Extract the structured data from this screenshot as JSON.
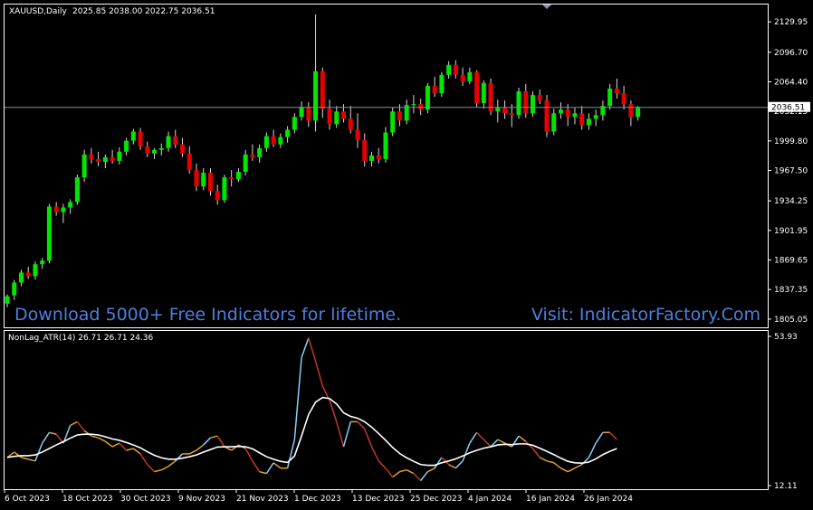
{
  "main": {
    "symbol_label": "XAUUSD,Daily",
    "ohlc_label": "2025.85 2038.00 2022.75 2036.51",
    "current_price_label": "2036.51",
    "banner_left": "Download 5000+ Free Indicators for lifetime.",
    "banner_right": "Visit: IndicatorFactory.Com"
  },
  "indicator": {
    "label": "NonLag_ATR(14) 26.71 26.71 24.36"
  },
  "colors": {
    "bull": "#00e600",
    "bear": "#e60000",
    "wick": "#d9d9d9",
    "grid_line": "#7f8f9f",
    "atr_up": "#87cefa",
    "atr_down": "#e0a030",
    "atr_mid": "#c0392b",
    "signal": "#ffffff",
    "banner": "#4d7fe0"
  },
  "chart_data": [
    {
      "type": "candlestick",
      "name": "price",
      "ylim": [
        1800.0,
        2140.0
      ],
      "y_ticks": [
        "2129.95",
        "2096.70",
        "2064.40",
        "2032.15",
        "1999.80",
        "1967.50",
        "1934.25",
        "1901.95",
        "1869.65",
        "1837.35",
        "1805.05"
      ],
      "current_price": 2036.51,
      "ohlc": [
        [
          1822,
          1832,
          1818,
          1830
        ],
        [
          1831,
          1848,
          1826,
          1845
        ],
        [
          1845,
          1859,
          1841,
          1856
        ],
        [
          1856,
          1862,
          1849,
          1852
        ],
        [
          1852,
          1868,
          1848,
          1865
        ],
        [
          1865,
          1872,
          1860,
          1869
        ],
        [
          1869,
          1931,
          1866,
          1928
        ],
        [
          1928,
          1933,
          1918,
          1922
        ],
        [
          1922,
          1931,
          1910,
          1927
        ],
        [
          1927,
          1936,
          1920,
          1933
        ],
        [
          1933,
          1963,
          1930,
          1960
        ],
        [
          1960,
          1990,
          1955,
          1985
        ],
        [
          1985,
          1992,
          1975,
          1980
        ],
        [
          1980,
          1988,
          1972,
          1977
        ],
        [
          1977,
          1985,
          1970,
          1982
        ],
        [
          1982,
          1990,
          1975,
          1978
        ],
        [
          1978,
          1993,
          1974,
          1988
        ],
        [
          1988,
          2003,
          1984,
          2000
        ],
        [
          2000,
          2013,
          1996,
          2010
        ],
        [
          2010,
          2014,
          1990,
          1994
        ],
        [
          1994,
          1999,
          1982,
          1986
        ],
        [
          1986,
          1992,
          1980,
          1990
        ],
        [
          1990,
          1997,
          1984,
          1992
        ],
        [
          1992,
          2010,
          1988,
          2005
        ],
        [
          2005,
          2012,
          1992,
          1996
        ],
        [
          1996,
          2003,
          1982,
          1986
        ],
        [
          1986,
          1994,
          1964,
          1968
        ],
        [
          1968,
          1975,
          1945,
          1950
        ],
        [
          1950,
          1970,
          1946,
          1965
        ],
        [
          1965,
          1970,
          1940,
          1945
        ],
        [
          1945,
          1952,
          1930,
          1935
        ],
        [
          1935,
          1963,
          1932,
          1960
        ],
        [
          1960,
          1968,
          1950,
          1958
        ],
        [
          1958,
          1970,
          1955,
          1966
        ],
        [
          1966,
          1990,
          1962,
          1985
        ],
        [
          1985,
          1996,
          1978,
          1982
        ],
        [
          1982,
          1996,
          1976,
          1992
        ],
        [
          1992,
          2009,
          1988,
          2005
        ],
        [
          2005,
          2012,
          1993,
          1996
        ],
        [
          1996,
          2008,
          1992,
          2004
        ],
        [
          2004,
          2016,
          1998,
          2012
        ],
        [
          2012,
          2030,
          2008,
          2026
        ],
        [
          2026,
          2043,
          2022,
          2037
        ],
        [
          2037,
          2042,
          2015,
          2022
        ],
        [
          2022,
          2138,
          2010,
          2076
        ],
        [
          2076,
          2080,
          2025,
          2035
        ],
        [
          2035,
          2045,
          2012,
          2018
        ],
        [
          2018,
          2038,
          2014,
          2032
        ],
        [
          2032,
          2040,
          2020,
          2024
        ],
        [
          2024,
          2038,
          2008,
          2012
        ],
        [
          2012,
          2030,
          1992,
          2001
        ],
        [
          2001,
          2008,
          1972,
          1978
        ],
        [
          1978,
          1988,
          1972,
          1984
        ],
        [
          1984,
          1992,
          1975,
          1980
        ],
        [
          1980,
          2015,
          1976,
          2009
        ],
        [
          2009,
          2036,
          2005,
          2032
        ],
        [
          2032,
          2040,
          2016,
          2022
        ],
        [
          2022,
          2045,
          2018,
          2039
        ],
        [
          2039,
          2050,
          2030,
          2040
        ],
        [
          2040,
          2046,
          2028,
          2034
        ],
        [
          2034,
          2063,
          2030,
          2060
        ],
        [
          2060,
          2070,
          2048,
          2052
        ],
        [
          2052,
          2075,
          2048,
          2072
        ],
        [
          2072,
          2087,
          2068,
          2083
        ],
        [
          2083,
          2088,
          2068,
          2072
        ],
        [
          2072,
          2080,
          2060,
          2065
        ],
        [
          2065,
          2080,
          2062,
          2075
        ],
        [
          2075,
          2077,
          2037,
          2041
        ],
        [
          2041,
          2066,
          2035,
          2063
        ],
        [
          2063,
          2068,
          2028,
          2032
        ],
        [
          2032,
          2045,
          2020,
          2036
        ],
        [
          2036,
          2044,
          2024,
          2030
        ],
        [
          2030,
          2040,
          2015,
          2028
        ],
        [
          2028,
          2058,
          2024,
          2054
        ],
        [
          2054,
          2062,
          2025,
          2030
        ],
        [
          2030,
          2054,
          2026,
          2050
        ],
        [
          2050,
          2056,
          2040,
          2044
        ],
        [
          2044,
          2050,
          2004,
          2010
        ],
        [
          2010,
          2035,
          2006,
          2030
        ],
        [
          2030,
          2042,
          2024,
          2034
        ],
        [
          2034,
          2040,
          2016,
          2026
        ],
        [
          2026,
          2036,
          2018,
          2030
        ],
        [
          2030,
          2038,
          2012,
          2017
        ],
        [
          2017,
          2030,
          2012,
          2024
        ],
        [
          2024,
          2034,
          2016,
          2028
        ],
        [
          2028,
          2044,
          2022,
          2038
        ],
        [
          2038,
          2062,
          2034,
          2057
        ],
        [
          2057,
          2068,
          2046,
          2052
        ],
        [
          2052,
          2060,
          2034,
          2040
        ],
        [
          2040,
          2044,
          2016,
          2026
        ],
        [
          2026,
          2038,
          2022,
          2036
        ]
      ]
    },
    {
      "type": "line",
      "name": "NonLag_ATR(14)",
      "ylim": [
        12.11,
        53.93
      ],
      "y_ticks": [
        "53.93",
        "12.11"
      ],
      "x_ticks": [
        "6 Oct 2023",
        "18 Oct 2023",
        "30 Oct 2023",
        "9 Nov 2023",
        "21 Nov 2023",
        "1 Dec 2023",
        "13 Dec 2023",
        "25 Dec 2023",
        "4 Jan 2024",
        "16 Jan 2024",
        "26 Jan 2024"
      ],
      "series": [
        {
          "role": "atr",
          "values": [
            20.0,
            21.5,
            20.0,
            19.5,
            19.0,
            24.0,
            27.0,
            26.5,
            24.0,
            29.0,
            30.0,
            27.5,
            26.0,
            25.5,
            24.5,
            23.0,
            24.0,
            22.0,
            22.5,
            21.0,
            18.0,
            16.0,
            16.5,
            17.5,
            19.0,
            21.0,
            21.0,
            22.0,
            23.5,
            25.5,
            26.0,
            23.0,
            22.0,
            23.5,
            22.5,
            19.0,
            16.0,
            15.5,
            18.5,
            17.0,
            17.0,
            25.0,
            48.0,
            53.5,
            47.0,
            40.0,
            36.0,
            30.0,
            23.0,
            30.0,
            30.0,
            28.0,
            23.0,
            19.0,
            17.0,
            14.5,
            16.0,
            16.5,
            15.5,
            13.5,
            16.0,
            17.0,
            20.0,
            18.0,
            17.0,
            19.0,
            24.0,
            27.0,
            25.0,
            23.0,
            25.0,
            24.0,
            23.0,
            26.0,
            24.5,
            22.5,
            20.0,
            19.0,
            18.5,
            17.0,
            16.0,
            17.0,
            18.0,
            20.0,
            24.0,
            27.0,
            27.0,
            25.0
          ]
        },
        {
          "role": "signal",
          "values": [
            20.0,
            20.3,
            20.5,
            20.5,
            20.7,
            21.5,
            22.5,
            23.5,
            24.4,
            25.4,
            26.3,
            26.5,
            26.5,
            26.3,
            25.8,
            25.2,
            24.8,
            24.2,
            23.5,
            22.7,
            21.6,
            20.6,
            19.9,
            19.5,
            19.5,
            19.8,
            20.2,
            20.7,
            21.5,
            22.2,
            22.9,
            23.0,
            23.0,
            23.1,
            23.0,
            22.4,
            21.3,
            20.2,
            19.5,
            18.9,
            18.6,
            20.4,
            26.0,
            32.0,
            35.5,
            36.8,
            36.5,
            35.0,
            32.5,
            31.5,
            31.0,
            30.0,
            28.5,
            26.7,
            24.8,
            22.8,
            21.1,
            19.9,
            18.9,
            18.0,
            17.8,
            17.8,
            18.5,
            19.0,
            19.6,
            20.4,
            21.3,
            22.0,
            22.6,
            23.0,
            23.5,
            23.7,
            23.6,
            23.8,
            23.8,
            23.4,
            22.6,
            21.7,
            20.8,
            19.8,
            18.9,
            18.5,
            18.4,
            18.7,
            19.6,
            20.8,
            21.7,
            22.5
          ]
        }
      ]
    }
  ]
}
